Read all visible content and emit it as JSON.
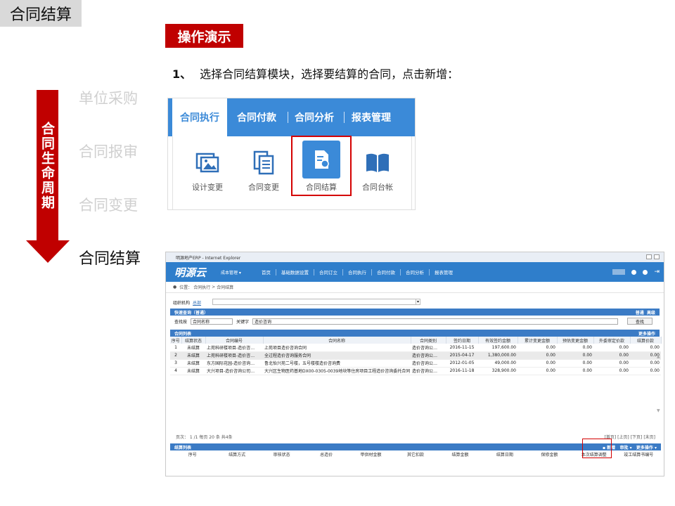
{
  "slide": {
    "title": "合同结算",
    "section_label": "操作演示",
    "step_number": "1、",
    "step_text": "选择合同结算模块，选择要结算的合同，点击新增：",
    "lifecycle_label": "合同生命周期",
    "stages": [
      "单位采购",
      "合同报审",
      "合同变更",
      "合同结算"
    ],
    "active_stage": "合同结算"
  },
  "module_menu": {
    "tabs": [
      "合同执行",
      "合同付款",
      "合同分析",
      "报表管理"
    ],
    "active_tab": "合同执行",
    "items": [
      {
        "label": "设计变更",
        "icon": "image-gallery-icon"
      },
      {
        "label": "合同变更",
        "icon": "documents-icon"
      },
      {
        "label": "合同结算",
        "icon": "settlement-document-icon"
      },
      {
        "label": "合同台帐",
        "icon": "open-book-icon"
      }
    ],
    "selected_item": "合同结算",
    "colors": {
      "nav": "#3b8ad8",
      "highlight": "#d40000"
    }
  },
  "erp": {
    "window_title": "明源地产ERP - Internet Explorer",
    "logo": "明源云",
    "module_select": "成本管理",
    "nav": [
      "首页",
      "基础数据设置",
      "合同订立",
      "合同执行",
      "合同付款",
      "合同分析",
      "报表管理"
    ],
    "breadcrumb": [
      "位置：",
      "合同执行",
      ">",
      "合同结算"
    ],
    "org_label": "组织机构",
    "org_value": "总部",
    "quick_search": {
      "title": "快速查询（普通）",
      "actions": [
        "普通",
        "高级"
      ],
      "sort_label": "查找按",
      "sort_value": "合同名称",
      "keyword_label": "关键字",
      "keyword_value": "造价咨询",
      "find_button": "查找"
    },
    "contract_list": {
      "title": "合同列表",
      "more": "更多操作",
      "columns": [
        "序号",
        "结算状态",
        "合同编号",
        "合同名称",
        "合同类别",
        "签约日期",
        "有效签约金额",
        "累计变更金额",
        "预估变更金额",
        "外委审定价款",
        "结算价款"
      ],
      "rows": [
        [
          "1",
          "未结算",
          "上苑科研楼项目-造价咨…",
          "上苑项目造价咨询合同",
          "造价咨询公…",
          "2016-11-15",
          "197,600.00",
          "0.00",
          "0.00",
          "0.00",
          "0.00"
        ],
        [
          "2",
          "未结算",
          "上苑科研楼项目-造价咨…",
          "全过程造价咨询服务合同",
          "造价咨询公…",
          "2015-04-17",
          "1,380,000.00",
          "0.00",
          "0.00",
          "0.00",
          "0.00"
        ],
        [
          "3",
          "未结算",
          "东方国际花园-造价咨询…",
          "鲁北怡兴苑二号楼，五号楼楼造价咨询费",
          "造价咨询公…",
          "2012-01-05",
          "49,000.00",
          "0.00",
          "0.00",
          "0.00",
          "0.00"
        ],
        [
          "4",
          "未结算",
          "大兴项目-造价咨询公司…",
          "大兴区生物医药基地DX00-0305-0039地块等住房项目工程造价咨询委托合同",
          "造价咨询公…",
          "2016-11-18",
          "328,900.00",
          "0.00",
          "0.00",
          "0.00",
          "0.00"
        ]
      ],
      "pager_left": "页次： 1 /1  每页 20 条 共4条",
      "pager_right": [
        "[首页]",
        "[上页]",
        "[下页]",
        "[末页]"
      ]
    },
    "settlement_list": {
      "title": "结算列表",
      "actions": [
        "新增",
        "审批",
        "更多操作"
      ],
      "columns": [
        "序号",
        "结算方式",
        "审核状态",
        "总造价",
        "甲供材金额",
        "其它扣款",
        "结算金额",
        "结算日期",
        "保修金额",
        "本次结算调整",
        "竣工结算书编号"
      ]
    }
  }
}
